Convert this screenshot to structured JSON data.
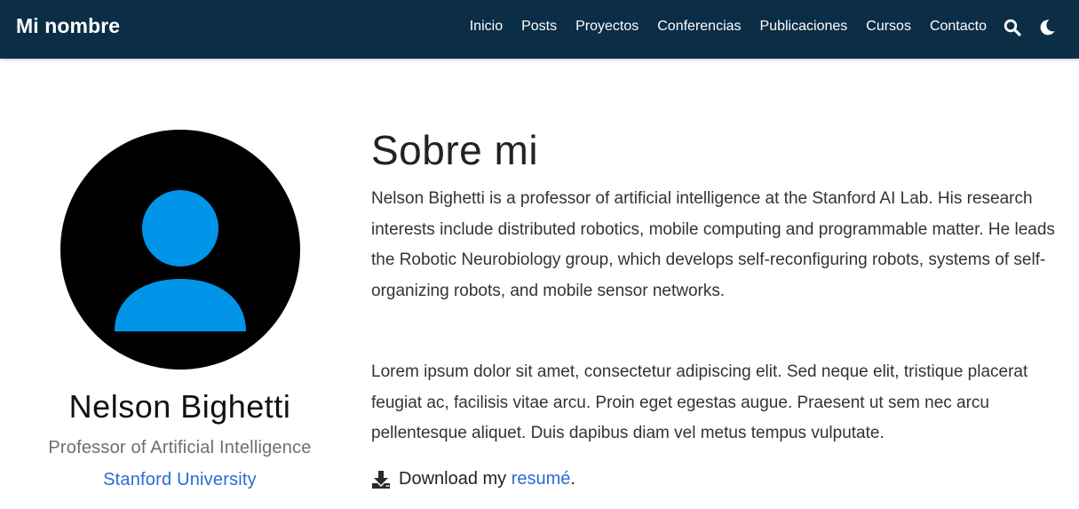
{
  "navbar": {
    "brand": "Mi nombre",
    "links": [
      {
        "label": "Inicio"
      },
      {
        "label": "Posts"
      },
      {
        "label": "Proyectos"
      },
      {
        "label": "Conferencias"
      },
      {
        "label": "Publicaciones"
      },
      {
        "label": "Cursos"
      },
      {
        "label": "Contacto"
      }
    ],
    "icons": [
      "search-icon",
      "moon-icon"
    ],
    "background_color": "#0b2e46"
  },
  "profile": {
    "avatar_icon": "user-avatar-icon",
    "avatar_colors": {
      "background": "#000000",
      "figure": "#0095e8"
    },
    "name": "Nelson Bighetti",
    "role": "Professor of Artificial Intelligence",
    "organization": "Stanford University"
  },
  "about": {
    "title": "Sobre mi",
    "paragraphs": [
      "Nelson Bighetti is a professor of artificial intelligence at the Stanford AI Lab. His research interests include distributed robotics, mobile computing and programmable matter. He leads the Robotic Neurobiology group, which develops self-reconfiguring robots, systems of self-organizing robots, and mobile sensor networks.",
      "Lorem ipsum dolor sit amet, consectetur adipiscing elit. Sed neque elit, tristique placerat feugiat ac, facilisis vitae arcu. Proin eget egestas augue. Praesent ut sem nec arcu pellentesque aliquet. Duis dapibus diam vel metus tempus vulputate."
    ],
    "resume": {
      "icon": "download-icon",
      "prefix": "Download my ",
      "link_text": "resumé",
      "suffix": "."
    }
  },
  "link_color": "#2b6bd6"
}
